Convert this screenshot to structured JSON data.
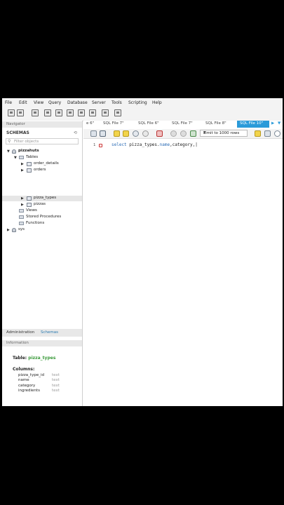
{
  "menu": [
    "File",
    "Edit",
    "View",
    "Query",
    "Database",
    "Server",
    "Tools",
    "Scripting",
    "Help"
  ],
  "navigator": {
    "header": "Navigator",
    "schemas_label": "SCHEMAS",
    "filter_placeholder": "Filter objects",
    "tree": {
      "db": "pizzahuts",
      "tables": "Tables",
      "table_items": [
        "order_details",
        "orders",
        "pizza_types",
        "pizzas"
      ],
      "views": "Views",
      "procs": "Stored Procedures",
      "functions": "Functions",
      "sys": "sys"
    },
    "bottom_tabs": [
      "Administration",
      "Schemas"
    ],
    "info_header": "Information"
  },
  "info": {
    "table_label": "Table:",
    "table_name": "pizza_types",
    "columns_label": "Columns:",
    "columns": [
      {
        "name": "pizza_type_id",
        "type": "text"
      },
      {
        "name": "name",
        "type": "text"
      },
      {
        "name": "category",
        "type": "text"
      },
      {
        "name": "ingredients",
        "type": "text"
      }
    ]
  },
  "query_tabs": [
    "e 6\"",
    "SQL File 7\"",
    "SQL File 6\"",
    "SQL File 7\"",
    "SQL File 8\"",
    "SQL File 10\""
  ],
  "active_tab": "SQL File 10\"",
  "limit_label": "Limit to 1000 rows",
  "editor": {
    "line": "1",
    "kw": "select",
    "text1": " pizza_types.",
    "kw2": "name",
    "text2": ",category,"
  },
  "colors": {
    "accent": "#2a9ad9",
    "keyword": "#2b6cb6",
    "table_name": "#3a9a3a",
    "schemas_tab": "#2a7ab0"
  }
}
